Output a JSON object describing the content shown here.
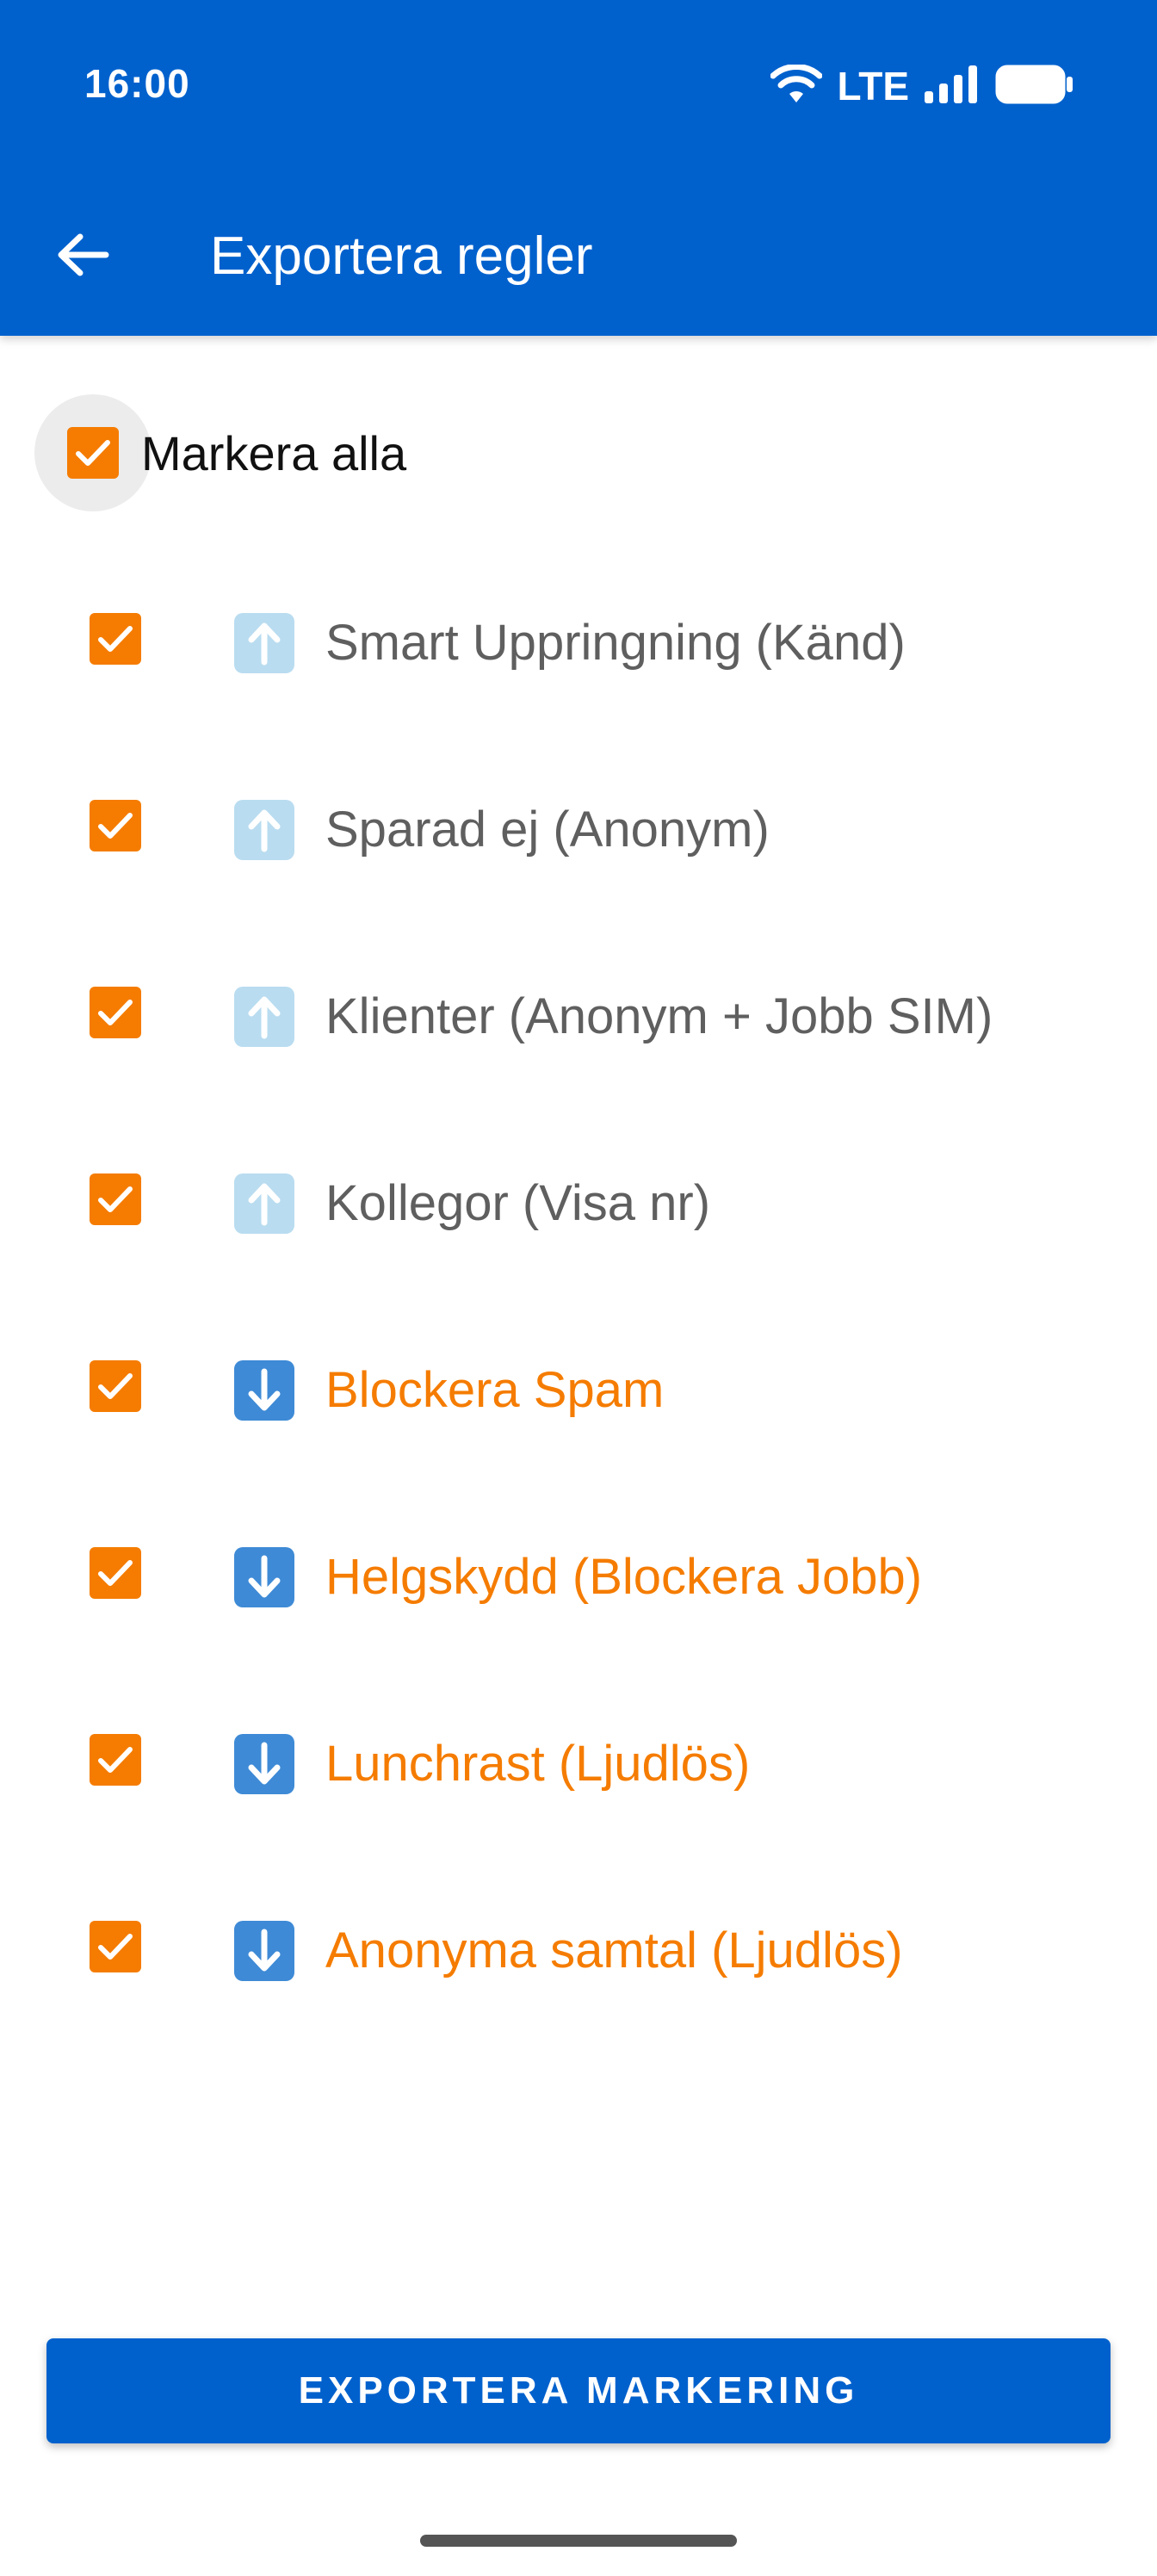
{
  "status_bar": {
    "time": "16:00",
    "network": "LTE",
    "icons": [
      "wifi-icon",
      "signal-icon",
      "battery-icon"
    ]
  },
  "toolbar": {
    "title": "Exportera regler",
    "back_icon": "back-arrow-icon"
  },
  "select_all": {
    "label": "Markera alla",
    "checked": true
  },
  "rules": [
    {
      "label": "Smart Uppringning (Känd)",
      "direction": "up",
      "checked": true,
      "color": "#5f5f5f"
    },
    {
      "label": "Sparad ej (Anonym)",
      "direction": "up",
      "checked": true,
      "color": "#5f5f5f"
    },
    {
      "label": "Klienter (Anonym + Jobb SIM)",
      "direction": "up",
      "checked": true,
      "color": "#5f5f5f"
    },
    {
      "label": "Kollegor (Visa nr)",
      "direction": "up",
      "checked": true,
      "color": "#5f5f5f"
    },
    {
      "label": "Blockera Spam",
      "direction": "down",
      "checked": true,
      "color": "#F57C00"
    },
    {
      "label": "Helgskydd (Blockera Jobb)",
      "direction": "down",
      "checked": true,
      "color": "#F57C00"
    },
    {
      "label": "Lunchrast (Ljudlös)",
      "direction": "down",
      "checked": true,
      "color": "#F57C00"
    },
    {
      "label": "Anonyma samtal (Ljudlös)",
      "direction": "down",
      "checked": true,
      "color": "#F57C00"
    }
  ],
  "export_button": {
    "label": "EXPORTERA MARKERING"
  },
  "colors": {
    "primary": "#0061CD",
    "accent": "#F57C00",
    "text_muted": "#5f5f5f"
  }
}
